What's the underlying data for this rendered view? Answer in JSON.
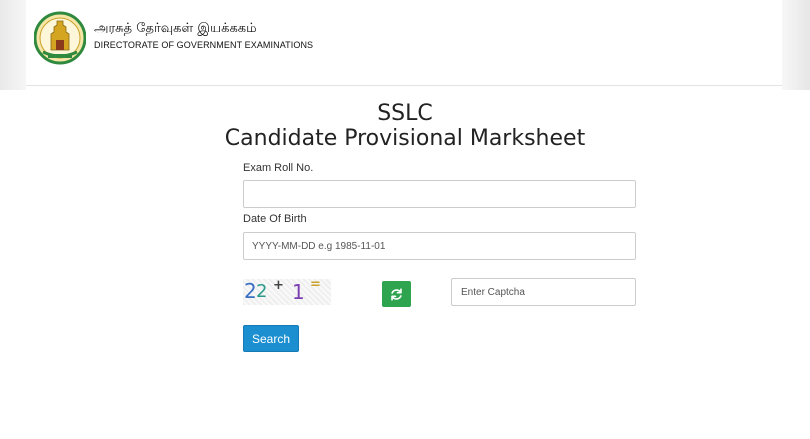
{
  "header": {
    "department_tamil": "அரசுத் தேர்வுகள் இயக்ககம்",
    "department_english": "DIRECTORATE OF GOVERNMENT EXAMINATIONS",
    "emblem_icon": "tamil-nadu-emblem-icon"
  },
  "page": {
    "title_line1": "SSLC",
    "title_line2": "Candidate Provisional Marksheet"
  },
  "form": {
    "roll_label": "Exam Roll No.",
    "roll_value": "",
    "roll_placeholder": "",
    "dob_label": "Date Of Birth",
    "dob_value": "",
    "dob_placeholder": "YYYY-MM-DD e.g 1985-11-01",
    "captcha_text": {
      "d1": "2",
      "d2": "2",
      "op": "+",
      "d3": "1",
      "eq": "="
    },
    "refresh_icon": "refresh-icon",
    "captcha_placeholder": "Enter Captcha",
    "search_label": "Search"
  },
  "colors": {
    "refresh_button": "#2ea44f",
    "search_button": "#1b8fd0"
  }
}
